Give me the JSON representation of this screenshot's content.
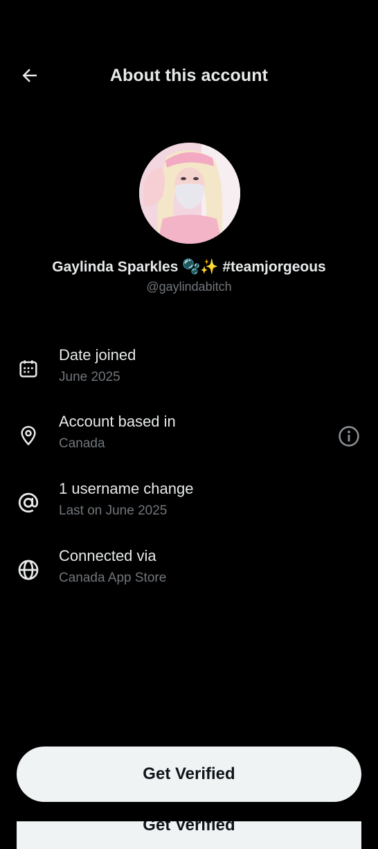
{
  "header": {
    "title": "About this account",
    "back_icon": "arrow-left-icon"
  },
  "profile": {
    "display_name": "Gaylinda Sparkles 🫧✨ #teamjorgeous",
    "handle": "@gaylindabitch"
  },
  "rows": [
    {
      "icon": "calendar-icon",
      "title": "Date joined",
      "subtitle": "June 2025"
    },
    {
      "icon": "location-pin-icon",
      "title": "Account based in",
      "subtitle": "Canada",
      "action_icon": "info-circle-icon"
    },
    {
      "icon": "at-sign-icon",
      "title": "1 username change",
      "subtitle": "Last on June 2025"
    },
    {
      "icon": "globe-icon",
      "title": "Connected via",
      "subtitle": "Canada App Store"
    }
  ],
  "footer": {
    "primary_button": "Get Verified"
  },
  "colors": {
    "background": "#000000",
    "primary_text": "#e7e9ea",
    "secondary_text": "#71767b",
    "button_bg": "#eff3f4",
    "button_text": "#0f1419"
  }
}
